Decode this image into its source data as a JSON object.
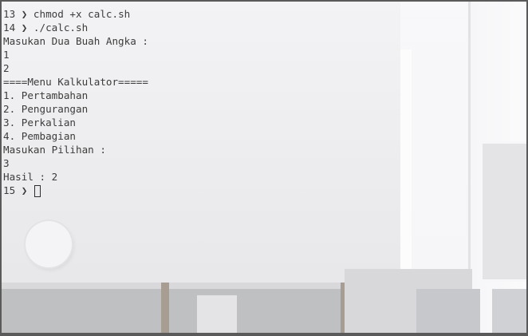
{
  "terminal": {
    "prompt_symbol": "❯",
    "lines": [
      {
        "kind": "prompt",
        "number": "13",
        "command": "chmod +x calc.sh"
      },
      {
        "kind": "prompt",
        "number": "14",
        "command": "./calc.sh"
      },
      {
        "kind": "output",
        "text": "Masukan Dua Buah Angka :"
      },
      {
        "kind": "output",
        "text": "1"
      },
      {
        "kind": "output",
        "text": "2"
      },
      {
        "kind": "output",
        "text": "====Menu Kalkulator====="
      },
      {
        "kind": "output",
        "text": "1. Pertambahan"
      },
      {
        "kind": "output",
        "text": "2. Pengurangan"
      },
      {
        "kind": "output",
        "text": "3. Perkalian"
      },
      {
        "kind": "output",
        "text": "4. Pembagian"
      },
      {
        "kind": "output",
        "text": "Masukan Pilihan :"
      },
      {
        "kind": "output",
        "text": "3"
      },
      {
        "kind": "output",
        "text": "Hasil : 2"
      },
      {
        "kind": "prompt",
        "number": "15",
        "command": "",
        "cursor": true
      }
    ]
  },
  "colors": {
    "text": "#3c3c3c",
    "border": "#5a5a5a"
  }
}
